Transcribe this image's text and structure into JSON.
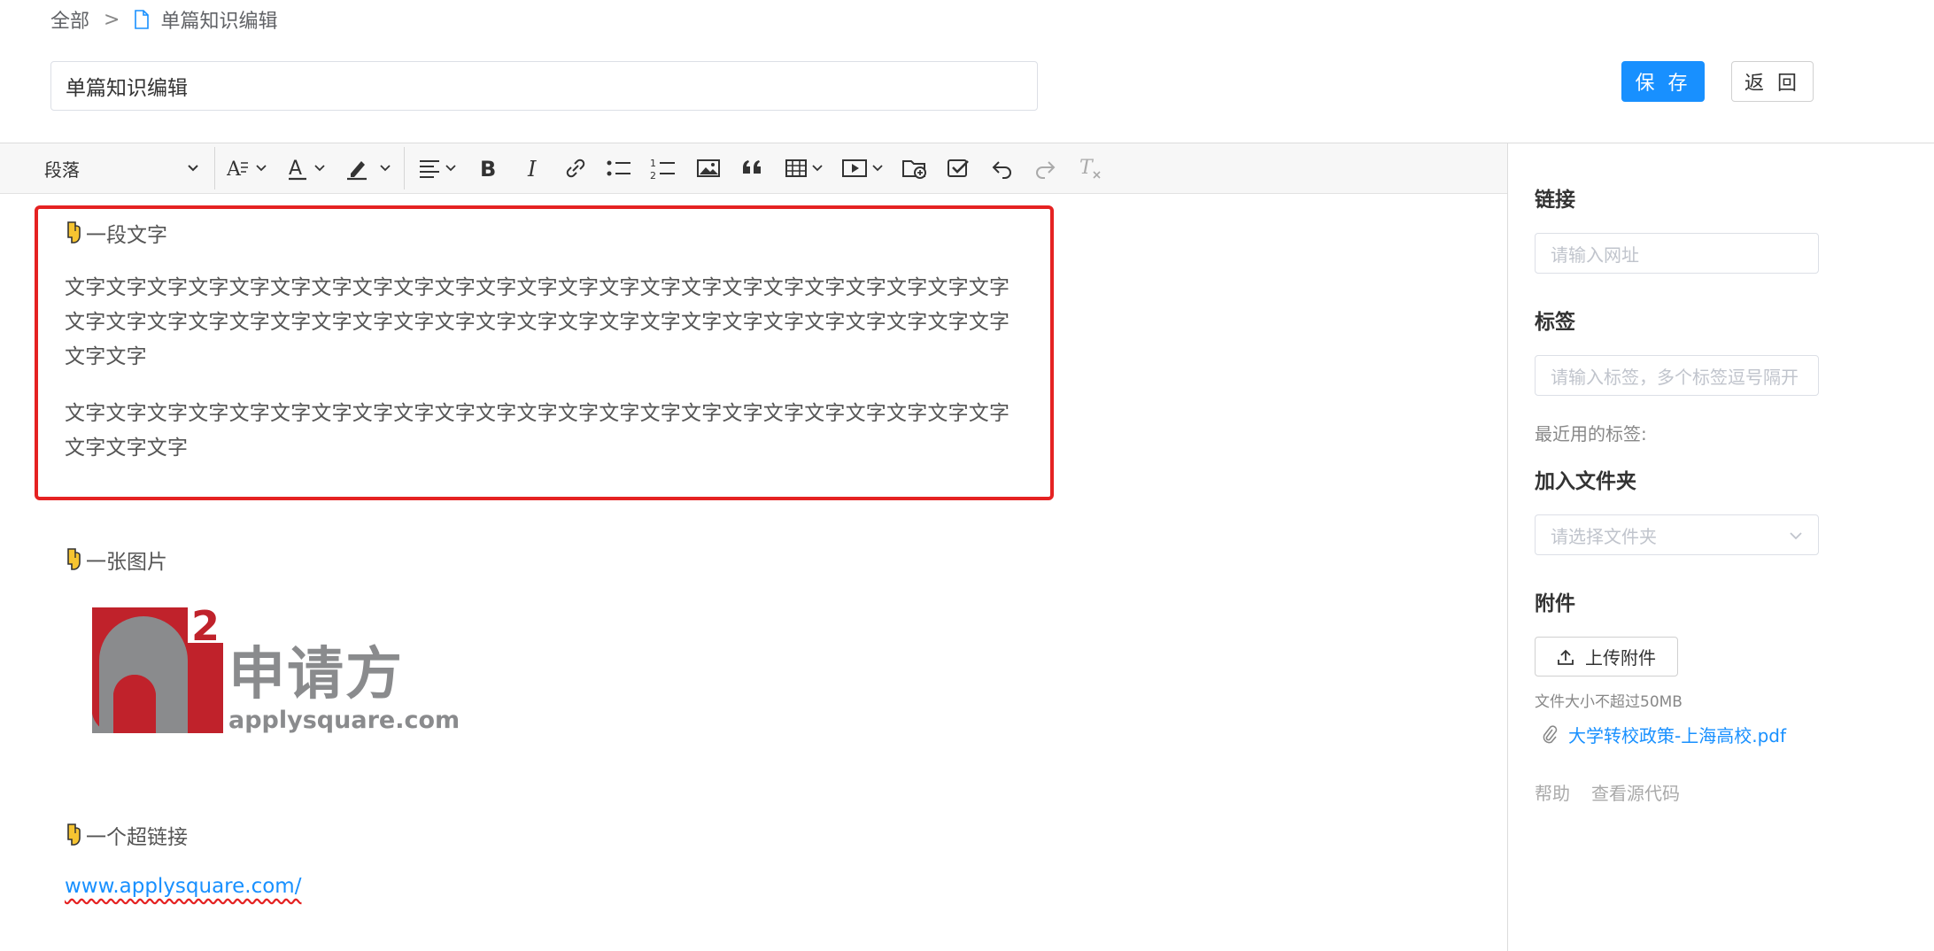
{
  "breadcrumb": {
    "root": "全部",
    "separator": ">",
    "current": "单篇知识编辑"
  },
  "header": {
    "title_value": "单篇知识编辑",
    "save_label": "保 存",
    "back_label": "返 回"
  },
  "toolbar": {
    "paragraph_select": "段落",
    "icons": [
      "font-size-icon",
      "font-color-icon",
      "highlight-icon",
      "align-icon",
      "bold-icon",
      "italic-icon",
      "link-icon",
      "bullet-list-icon",
      "numbered-list-icon",
      "image-icon",
      "quote-icon",
      "table-icon",
      "video-icon",
      "folder-add-icon",
      "todo-icon",
      "undo-icon",
      "redo-icon",
      "clear-format-icon"
    ]
  },
  "editor": {
    "section1_heading": "一段文字",
    "para1_line1": "文字文字文字文字文字文字文字文字文字文字文字文字文字文字文字文字文字文字文字文字文字文字文字",
    "para1_line2": "文字文字文字文字文字文字文字文字文字文字文字文字文字文字文字文字文字文字文字文字文字文字文字",
    "para1_line3": "文字文字",
    "para2_line1": "文字文字文字文字文字文字文字文字文字文字文字文字文字文字文字文字文字文字文字文字文字文字文字",
    "para2_line2": "文字文字文字",
    "section2_heading": "一张图片",
    "logo": {
      "superscript": "2",
      "cn_name": "申请方",
      "domain": "applysquare.com"
    },
    "section3_heading": "一个超链接",
    "link_text": "www.applysquare.com/"
  },
  "sidebar": {
    "link_label": "链接",
    "link_placeholder": "请输入网址",
    "tags_label": "标签",
    "tags_placeholder": "请输入标签，多个标签逗号隔开",
    "recent_tags_label": "最近用的标签:",
    "folder_label": "加入文件夹",
    "folder_placeholder": "请选择文件夹",
    "attachment_label": "附件",
    "upload_label": "上传附件",
    "file_note": "文件大小不超过50MB",
    "attachment_name": "大学转校政策-上海高校.pdf",
    "help_label": "帮助",
    "source_label": "查看源代码"
  },
  "colors": {
    "primary": "#1890ff",
    "highlight_border": "#e52222",
    "logo_red": "#c0222b",
    "logo_gray": "#8a8b8d"
  }
}
